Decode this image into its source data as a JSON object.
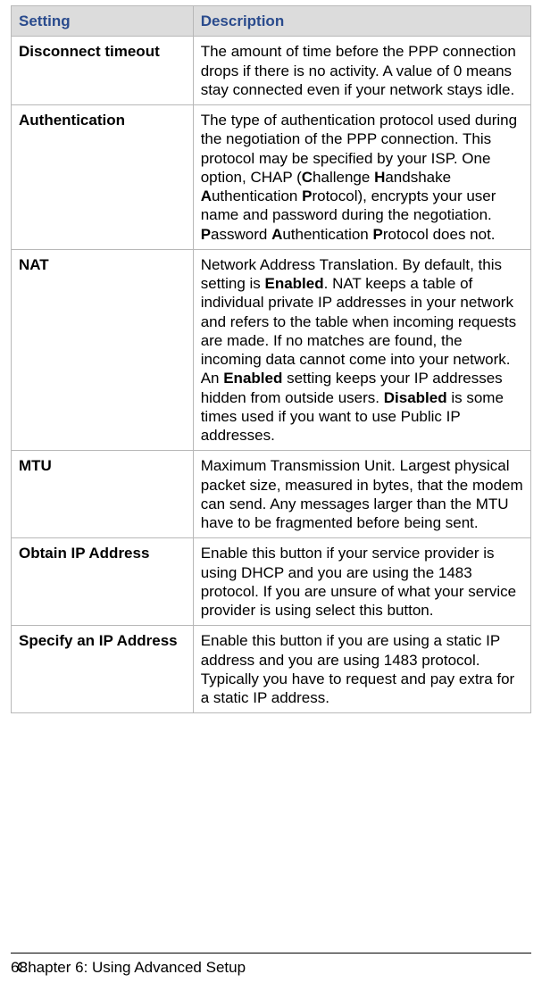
{
  "headers": {
    "setting": "Setting",
    "description": "Description"
  },
  "rows": [
    {
      "setting": "Disconnect timeout",
      "desc": "The amount of time before the PPP connection drops if there is no activity. A value of 0 means stay connected even if your network stays idle."
    },
    {
      "setting": "Authentication",
      "desc_parts": {
        "t0": "The type of authentication protocol used during the negotiation of the PPP connection. This protocol may be specified by your ISP. One option, CHAP (",
        "b0": "C",
        "t1": "hallenge ",
        "b1": "H",
        "t2": "andshake ",
        "b2": "A",
        "t3": "uthentication ",
        "b3": "P",
        "t4": "rotocol), encrypts your user name and password during the negotiation. ",
        "b4": "P",
        "t5": "assword ",
        "b5": "A",
        "t6": "uthentication ",
        "b6": "P",
        "t7": "rotocol does not."
      }
    },
    {
      "setting": "NAT",
      "desc_parts": {
        "t0": "Network Address Translation. By default, this setting is ",
        "b0": "Enabled",
        "t1": ". NAT keeps a table of individual private IP addresses in your network and refers to the table when incoming requests are made. If no matches are found, the incoming data cannot come into your network. An ",
        "b1": "Enabled",
        "t2": " setting keeps your IP addresses hidden from outside users. ",
        "b2": "Disabled",
        "t3": " is some times used if you want to use Public IP addresses."
      }
    },
    {
      "setting": "MTU",
      "desc": "Maximum Transmission Unit. Largest physical packet size, measured in bytes, that the modem can send. Any messages larger than the MTU have to be fragmented before being sent."
    },
    {
      "setting": "Obtain IP Address",
      "desc": "Enable this button if your service provider is using DHCP and you are using the 1483 protocol. If you are unsure of what your service provider is using select this button."
    },
    {
      "setting": "Specify an IP Address",
      "desc": "Enable this button if you are using a static IP address and you are using 1483 protocol. Typically you have to request and pay extra for a static IP address."
    }
  ],
  "footer": {
    "page": "68",
    "chapter_prefix": "Chapter 6: ",
    "chapter_title": "Using Advanced Setup"
  }
}
